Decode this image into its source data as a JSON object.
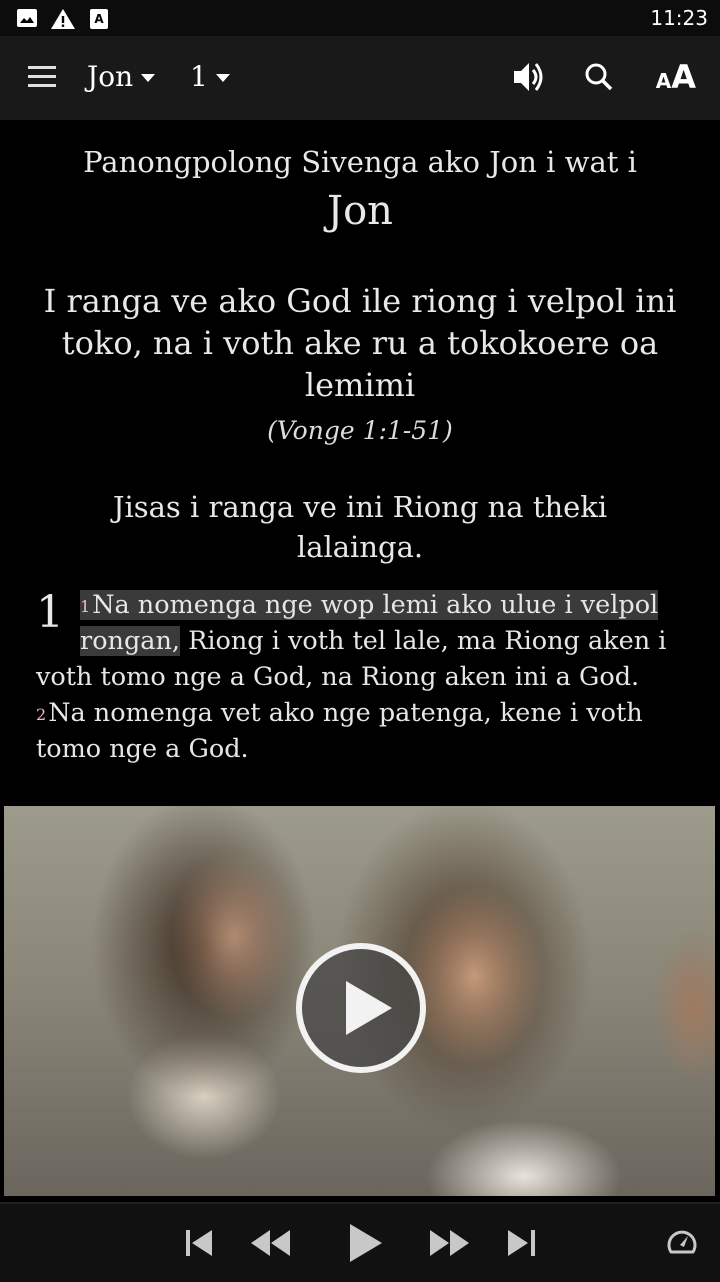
{
  "status_bar": {
    "time": "11:23",
    "icons": [
      "image-icon",
      "warning-icon",
      "font-download-icon"
    ]
  },
  "app_bar": {
    "menu_icon": "hamburger-menu-icon",
    "book_selector": "Jon",
    "chapter_selector": "1",
    "actions": [
      "speaker-icon",
      "search-icon",
      "text-size-icon"
    ],
    "text_size_label_small": "A",
    "text_size_label_big": "A"
  },
  "content": {
    "book_intro": "Panongpolong Sivenga ako Jon i wat i",
    "book_title": "Jon",
    "section_title": "I ranga ve ako God ile riong i velpol ini toko, na i voth ake ru a tokokoere oa lemimi",
    "section_ref": "(Vonge 1:1-51)",
    "subsection_title": "Jisas i ranga ve ini Riong na theki lalainga.",
    "chapter_number": "1",
    "verses": [
      {
        "number": "1",
        "highlighted_text": "Na nomenga nge wop lemi ako ulue i velpol rongan,",
        "text": " Riong i voth tel lale, ma Riong aken i voth tomo nge a God, na Riong aken ini a God."
      },
      {
        "number": "2",
        "text": "Na nomenga vet ako nge patenga, kene i voth tomo nge a God."
      }
    ]
  },
  "video": {
    "thumbnail": "video-thumbnail",
    "play_icon": "play-circle-icon"
  },
  "player": {
    "controls": [
      "skip-previous-icon",
      "rewind-icon",
      "play-icon",
      "fast-forward-icon",
      "skip-next-icon"
    ],
    "speed_icon": "speedometer-icon"
  },
  "colors": {
    "background": "#000000",
    "app_bar": "#191919",
    "text": "#e6e6e6",
    "verse_number": "#f2b8c6",
    "highlight": "#3a3a3a",
    "player_bar": "#111111"
  }
}
